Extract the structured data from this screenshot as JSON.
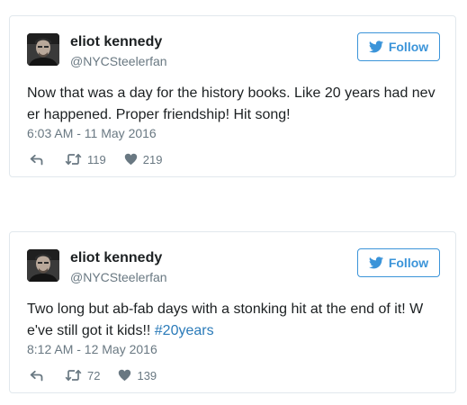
{
  "tweets": [
    {
      "display_name": "eliot kennedy",
      "handle": "@NYCSteelerfan",
      "follow_label": "Follow",
      "text_lines": [
        "Now that was a day for the history books. Like 20 years had nev",
        "er happened. Proper friendship! Hit song!"
      ],
      "timestamp": "6:03 AM - 11 May 2016",
      "retweet_count": "119",
      "like_count": "219"
    },
    {
      "display_name": "eliot kennedy",
      "handle": "@NYCSteelerfan",
      "follow_label": "Follow",
      "text_lines": [
        "Two long but ab-fab days with a stonking hit at the end of it! W",
        "e've still got it kids!! "
      ],
      "hashtag": "#20years",
      "timestamp": "8:12 AM - 12 May 2016",
      "retweet_count": "72",
      "like_count": "139"
    }
  ],
  "icons": {
    "follow": "twitter-bird-icon",
    "reply": "reply-arrow-icon",
    "retweet": "retweet-icon",
    "like": "heart-icon"
  },
  "colors": {
    "accent": "#3b94d9",
    "hashtag": "#2b7bb9",
    "text": "#1c2022",
    "muted": "#697882",
    "border": "#e1e8ed"
  }
}
